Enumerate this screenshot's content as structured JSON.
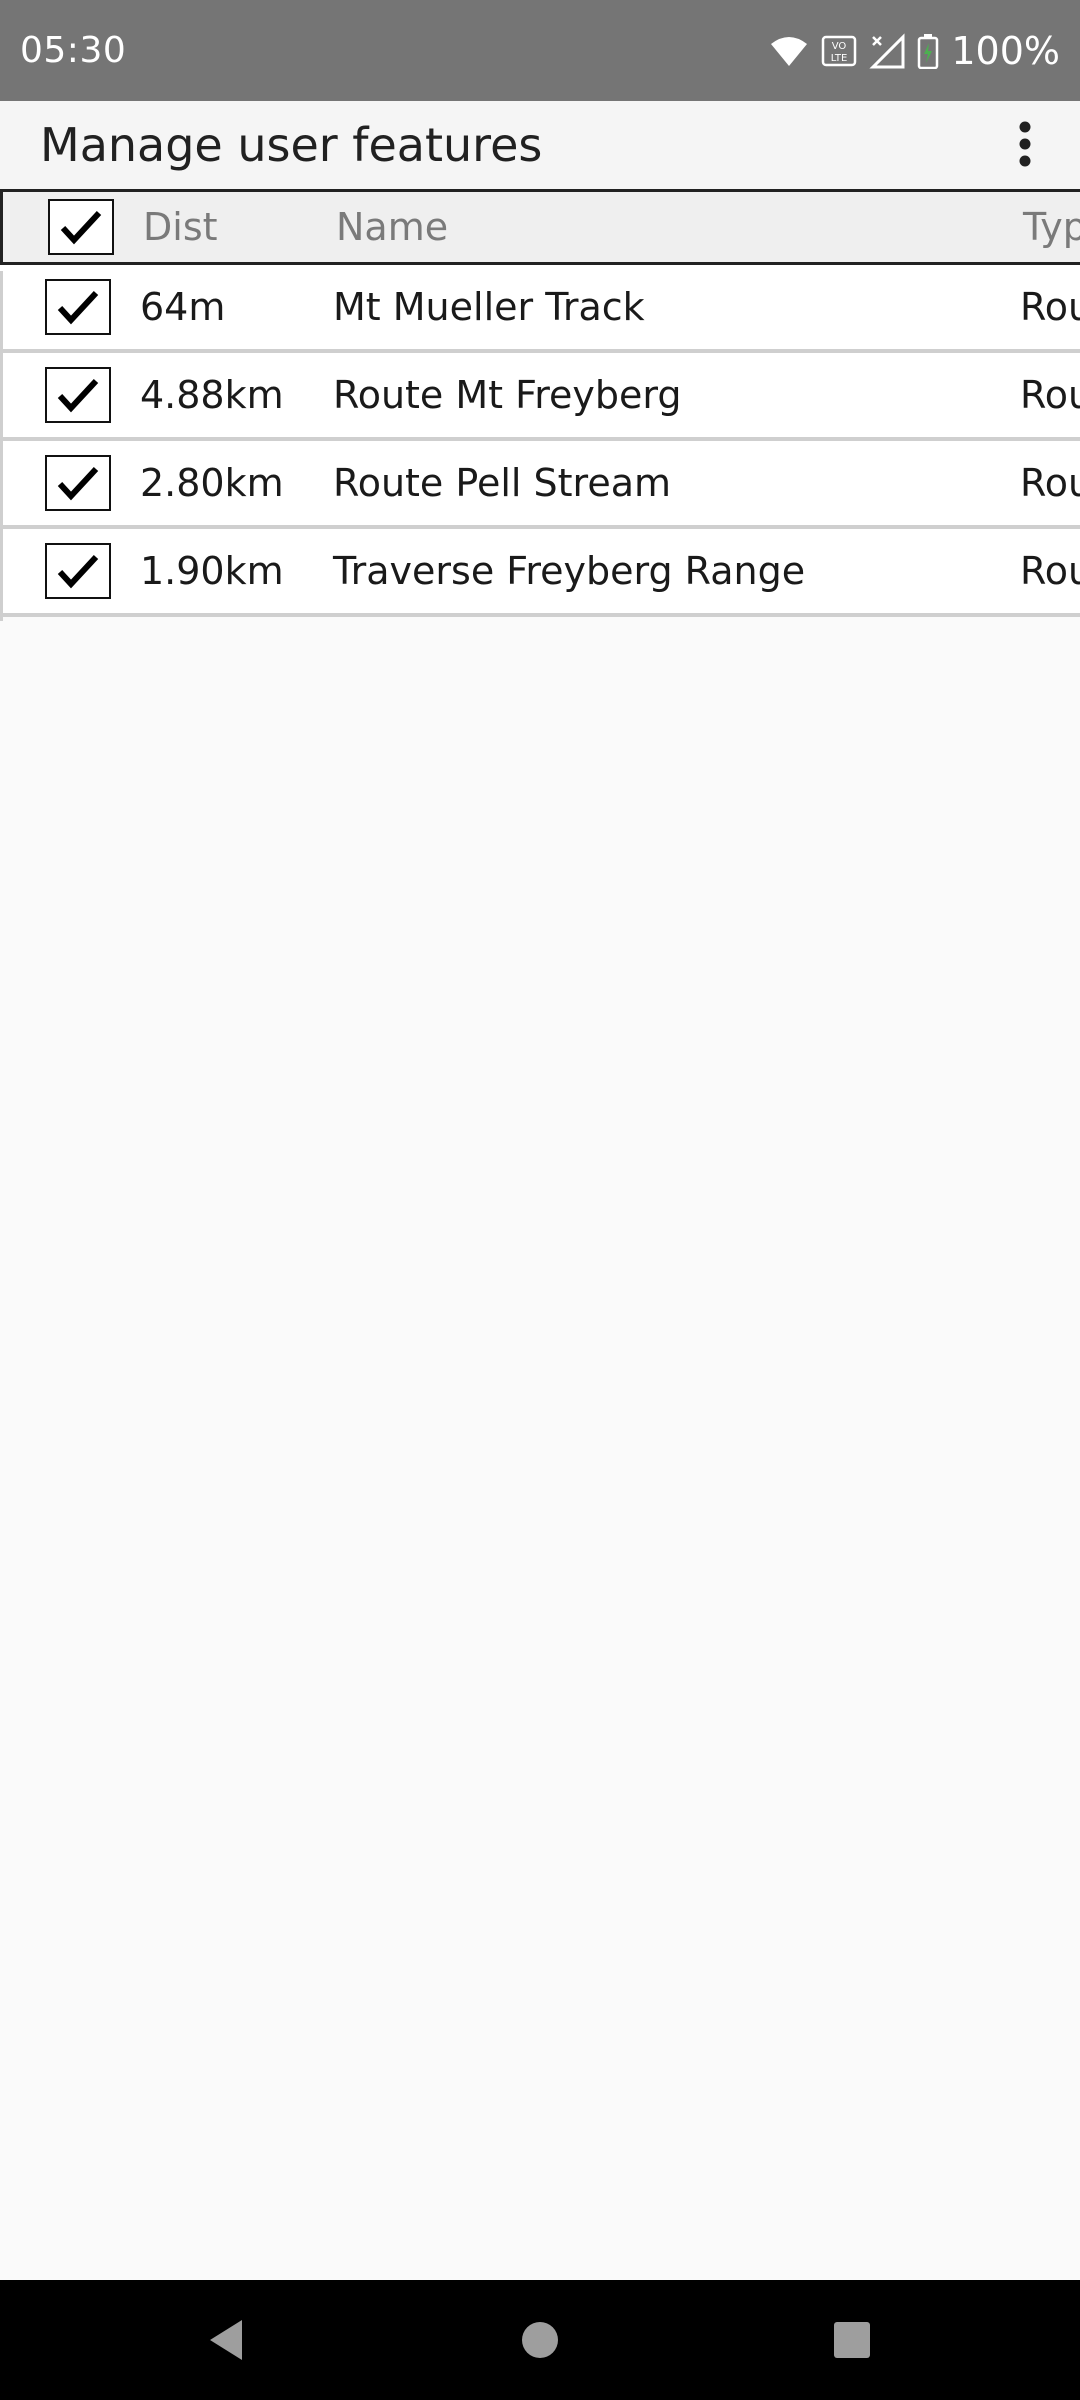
{
  "status_bar": {
    "time": "05:30",
    "battery": "100%",
    "icons": [
      "wifi-icon",
      "volte-icon",
      "signal-icon",
      "battery-charging-icon"
    ]
  },
  "app_bar": {
    "title": "Manage user features",
    "menu_icon": "more-vert-icon"
  },
  "table": {
    "header": {
      "checked": true,
      "dist": "Dist",
      "name": "Name",
      "type": "Typ"
    },
    "rows": [
      {
        "checked": true,
        "dist": "64m",
        "name": "Mt Mueller Track",
        "type": "Rou"
      },
      {
        "checked": true,
        "dist": "4.88km",
        "name": "Route Mt Freyberg",
        "type": "Rou"
      },
      {
        "checked": true,
        "dist": "2.80km",
        "name": "Route Pell Stream",
        "type": "Rou"
      },
      {
        "checked": true,
        "dist": "1.90km",
        "name": "Traverse Freyberg Range",
        "type": "Rou"
      }
    ]
  },
  "nav_bar": {
    "icons": [
      "back-icon",
      "home-icon",
      "recents-icon"
    ]
  },
  "colors": {
    "status_bar": "#757575",
    "app_bar": "#f5f5f5",
    "background": "#fafafa",
    "nav_bar": "#000000"
  }
}
